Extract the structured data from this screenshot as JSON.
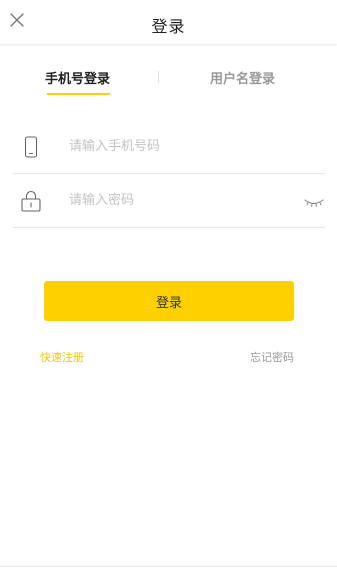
{
  "header": {
    "title": "登录",
    "close_icon": "close-icon"
  },
  "tabs": [
    {
      "label": "手机号登录",
      "active": true
    },
    {
      "label": "用户名登录",
      "active": false
    }
  ],
  "form": {
    "phone": {
      "icon": "phone-icon",
      "placeholder": "请输入手机号码",
      "value": ""
    },
    "password": {
      "icon": "lock-icon",
      "placeholder": "请输入密码",
      "value": "",
      "toggle_icon": "eye-closed-icon"
    }
  },
  "submit_label": "登录",
  "links": {
    "register": "快速注册",
    "forgot_password": "忘记密码"
  },
  "colors": {
    "accent": "#ffd000",
    "register_link": "#f5c600",
    "muted_text": "#999999",
    "placeholder": "#c3c3c3"
  }
}
